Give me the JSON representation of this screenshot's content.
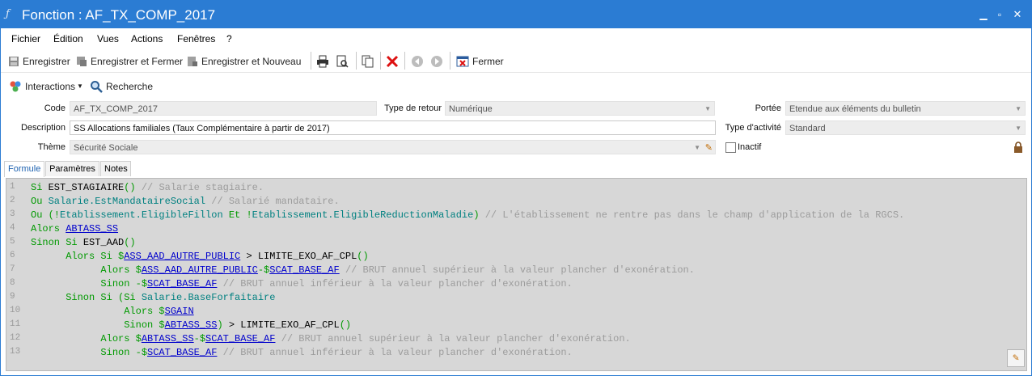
{
  "window": {
    "title": "Fonction : AF_TX_COMP_2017"
  },
  "menu": [
    "Fichier",
    "Édition",
    "Vues",
    "Actions",
    "Fenêtres",
    "?"
  ],
  "toolbar": {
    "save": "Enregistrer",
    "save_close": "Enregistrer et Fermer",
    "save_new": "Enregistrer et Nouveau",
    "close": "Fermer"
  },
  "toolbar2": {
    "interactions": "Interactions",
    "search": "Recherche"
  },
  "form": {
    "code_label": "Code",
    "code_value": "AF_TX_COMP_2017",
    "return_type_label": "Type de retour",
    "return_type_value": "Numérique",
    "scope_label": "Portée",
    "scope_value": "Etendue aux éléments du bulletin",
    "description_label": "Description",
    "description_value": "SS Allocations familiales (Taux Complémentaire à partir de 2017)",
    "activity_type_label": "Type d'activité",
    "activity_type_value": "Standard",
    "theme_label": "Thème",
    "theme_value": "Sécurité Sociale",
    "inactive_label": "Inactif",
    "inactive_checked": false
  },
  "tabs": [
    {
      "label": "Formule",
      "active": true
    },
    {
      "label": "Paramètres",
      "active": false
    },
    {
      "label": "Notes",
      "active": false
    }
  ],
  "code": [
    {
      "n": "1",
      "tokens": [
        [
          "kw",
          "Si "
        ],
        [
          "fn",
          "EST_STAGIAIRE"
        ],
        [
          "kw",
          "() "
        ],
        [
          "cm",
          "// Salarie stagiaire."
        ]
      ]
    },
    {
      "n": "2",
      "tokens": [
        [
          "kw",
          "Ou "
        ],
        [
          "ob",
          "Salarie.EstMandataireSocial"
        ],
        [
          "cm",
          " // Salarié mandataire."
        ]
      ]
    },
    {
      "n": "3",
      "tokens": [
        [
          "kw",
          "Ou (!"
        ],
        [
          "ob",
          "Etablissement.EligibleFillon"
        ],
        [
          "kw",
          " Et !"
        ],
        [
          "ob",
          "Etablissement.EligibleReductionMaladie"
        ],
        [
          "kw",
          ")"
        ],
        [
          "cm",
          " // L'établissement ne rentre pas dans le champ d'application de la RGCS."
        ]
      ]
    },
    {
      "n": "4",
      "tokens": [
        [
          "kw",
          "Alors "
        ],
        [
          "vr",
          "ABTASS_SS"
        ]
      ]
    },
    {
      "n": "5",
      "tokens": [
        [
          "kw",
          "Sinon Si "
        ],
        [
          "fn",
          "EST_AAD"
        ],
        [
          "kw",
          "()"
        ]
      ]
    },
    {
      "n": "6",
      "tokens": [
        [
          "kw",
          "      Alors Si $"
        ],
        [
          "vr",
          "ASS_AAD_AUTRE_PUBLIC"
        ],
        [
          "op",
          " > "
        ],
        [
          "fn",
          "LIMITE_EXO_AF_CPL"
        ],
        [
          "kw",
          "()"
        ]
      ]
    },
    {
      "n": "7",
      "tokens": [
        [
          "kw",
          "            Alors $"
        ],
        [
          "vr",
          "ASS_AAD_AUTRE_PUBLIC"
        ],
        [
          "kw",
          "-$"
        ],
        [
          "vr",
          "SCAT_BASE_AF"
        ],
        [
          "cm",
          " // BRUT annuel supérieur à la valeur plancher d'exonération."
        ]
      ]
    },
    {
      "n": "8",
      "tokens": [
        [
          "kw",
          "            Sinon -$"
        ],
        [
          "vr",
          "SCAT_BASE_AF"
        ],
        [
          "cm",
          " // BRUT annuel inférieur à la valeur plancher d'exonération."
        ]
      ]
    },
    {
      "n": "9",
      "tokens": [
        [
          "kw",
          "      Sinon Si (Si "
        ],
        [
          "ob",
          "Salarie.BaseForfaitaire"
        ]
      ]
    },
    {
      "n": "10",
      "tokens": [
        [
          "kw",
          "                Alors $"
        ],
        [
          "vr",
          "SGAIN"
        ]
      ]
    },
    {
      "n": "11",
      "tokens": [
        [
          "kw",
          "                Sinon $"
        ],
        [
          "vr",
          "ABTASS_SS"
        ],
        [
          "kw",
          ")"
        ],
        [
          "op",
          " > "
        ],
        [
          "fn",
          "LIMITE_EXO_AF_CPL"
        ],
        [
          "kw",
          "()"
        ]
      ]
    },
    {
      "n": "12",
      "tokens": [
        [
          "kw",
          "            Alors $"
        ],
        [
          "vr",
          "ABTASS_SS"
        ],
        [
          "kw",
          "-$"
        ],
        [
          "vr",
          "SCAT_BASE_AF"
        ],
        [
          "cm",
          " // BRUT annuel supérieur à la valeur plancher d'exonération."
        ]
      ]
    },
    {
      "n": "13",
      "tokens": [
        [
          "kw",
          "            Sinon -$"
        ],
        [
          "vr",
          "SCAT_BASE_AF"
        ],
        [
          "cm",
          " // BRUT annuel inférieur à la valeur plancher d'exonération."
        ]
      ]
    }
  ],
  "colors": {
    "title_bar": "#2b7cd3",
    "editor_bg": "#d7d7d7",
    "keyword": "#009900",
    "variable": "#0000cc",
    "comment": "#9c9c9c"
  },
  "icons": [
    "app-icon",
    "minimize-icon",
    "maximize-icon",
    "close-window-icon",
    "save-icon",
    "save-close-icon",
    "save-new-icon",
    "print-icon",
    "print-preview-icon",
    "copy-icon",
    "delete-icon",
    "previous-icon",
    "next-icon",
    "close-icon",
    "interactions-icon",
    "search-icon",
    "dropdown-caret-icon",
    "edit-pencil-icon",
    "lock-icon"
  ]
}
